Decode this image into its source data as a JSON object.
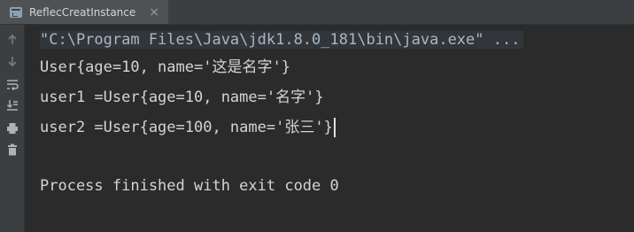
{
  "tab": {
    "title": "ReflecCreatInstance",
    "close": "×",
    "icon": "run-config-icon"
  },
  "gutter": {
    "icons": [
      "arrow-up-icon",
      "arrow-down-icon",
      "soft-wrap-icon",
      "scroll-to-end-icon",
      "print-icon",
      "trash-icon"
    ]
  },
  "console": {
    "lines": [
      "\"C:\\Program Files\\Java\\jdk1.8.0_181\\bin\\java.exe\" ...",
      "User{age=10, name='这是名字'}",
      "user1 =User{age=10, name='名字'}",
      "user2 =User{age=100, name='张三'}",
      "",
      "Process finished with exit code 0"
    ]
  },
  "colors": {
    "background": "#2b2b2b",
    "gutter": "#3c3f41",
    "tab_active": "#4e5254",
    "text": "#d4d4d4",
    "command_text": "#a9b7c6"
  }
}
